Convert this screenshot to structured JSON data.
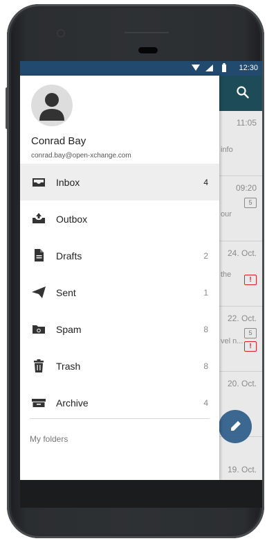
{
  "status": {
    "time": "12:30"
  },
  "account": {
    "name": "Conrad Bay",
    "email": "conrad.bay@open-xchange.com"
  },
  "folders": [
    {
      "label": "Inbox",
      "count": "4",
      "icon": "inbox-icon"
    },
    {
      "label": "Outbox",
      "count": "",
      "icon": "outbox-icon"
    },
    {
      "label": "Drafts",
      "count": "2",
      "icon": "drafts-icon"
    },
    {
      "label": "Sent",
      "count": "1",
      "icon": "sent-icon"
    },
    {
      "label": "Spam",
      "count": "8",
      "icon": "spam-icon"
    },
    {
      "label": "Trash",
      "count": "8",
      "icon": "trash-icon"
    },
    {
      "label": "Archive",
      "count": "4",
      "icon": "archive-icon"
    }
  ],
  "my_folders_label": "My folders",
  "background_list": [
    {
      "date": "11:05",
      "snippet": "info"
    },
    {
      "date": "09:20",
      "snippet": "our",
      "badge": "5"
    },
    {
      "date": "24. Oct.",
      "snippet": "the",
      "flag": "!"
    },
    {
      "date": "22. Oct.",
      "snippet": "vel n...",
      "badge": "5",
      "flag": "!"
    },
    {
      "date": "20. Oct.",
      "snippet": ""
    },
    {
      "date": "19. Oct.",
      "snippet": ""
    }
  ],
  "colors": {
    "status_bar": "#22496e",
    "app_bar": "#1d4c58",
    "fab": "#2a5a87"
  }
}
